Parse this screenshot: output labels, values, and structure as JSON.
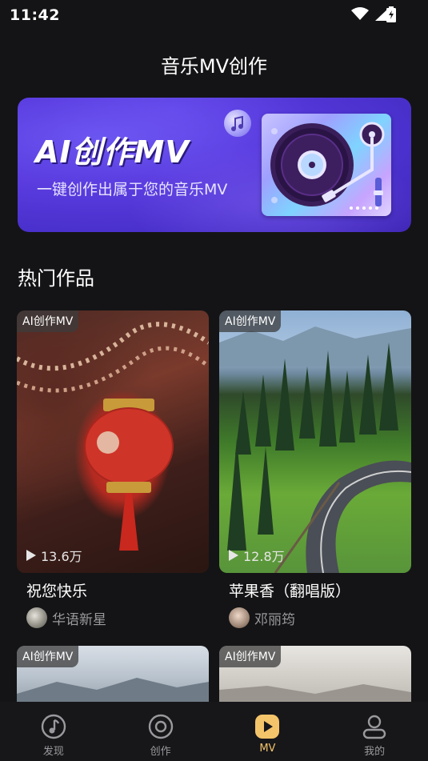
{
  "status_bar": {
    "time": "11:42"
  },
  "header": {
    "title": "音乐MV创作"
  },
  "banner": {
    "heading": "AI创作MV",
    "subtitle": "一键创作出属于您的音乐MV",
    "accent_color": "#5b3de0"
  },
  "section": {
    "heading": "热门作品"
  },
  "cards": [
    {
      "tag": "AI创作MV",
      "plays": "13.6万",
      "title": "祝您快乐",
      "author": "华语新星"
    },
    {
      "tag": "AI创作MV",
      "plays": "12.8万",
      "title": "苹果香（翻唱版）",
      "author": "邓丽筠"
    },
    {
      "tag": "AI创作MV"
    },
    {
      "tag": "AI创作MV"
    }
  ],
  "bottom_nav": {
    "items": [
      {
        "label": "发现",
        "icon": "music-note-icon"
      },
      {
        "label": "创作",
        "icon": "record-icon"
      },
      {
        "label": "MV",
        "icon": "play-icon",
        "active": true
      },
      {
        "label": "我的",
        "icon": "user-icon"
      }
    ],
    "active_color": "#f4c46a"
  }
}
